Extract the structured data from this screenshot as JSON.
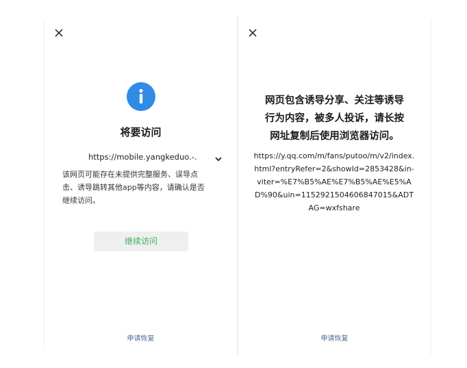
{
  "left_dialog": {
    "close_icon": "close-icon",
    "status_icon": "info-icon",
    "accent_color": "#2f8be6",
    "title": "将要访问",
    "url": "https://mobile.yangkeduo.-...",
    "expand_icon": "chevron-down-icon",
    "notice_lines": [
      "该网页可能存在未提供完整服务、误导点",
      "击、诱导跳转其他app等内容，请确认是否",
      "继续访问。"
    ],
    "continue_label": "继续访问",
    "continue_color": "#3bb15a",
    "appeal_label": "申请恢复"
  },
  "right_dialog": {
    "close_icon": "close-icon",
    "warning_lines": [
      "网页包含诱导分享、关注等诱导",
      "行为内容，被多人投诉，请长按",
      "网址复制后使用浏览器访问。"
    ],
    "url_lines": [
      "https://y.qq.com/m/fans/putoo/m/v2/index.",
      "html?entryRefer=2&showId=2853428&in-",
      "viter=%E7%B5%AE%E7%B5%AE%E5%A",
      "D%90&uin=1152921504606847015&ADT",
      "AG=wxfshare"
    ],
    "appeal_label": "申请恢复",
    "link_color": "#506a94"
  }
}
